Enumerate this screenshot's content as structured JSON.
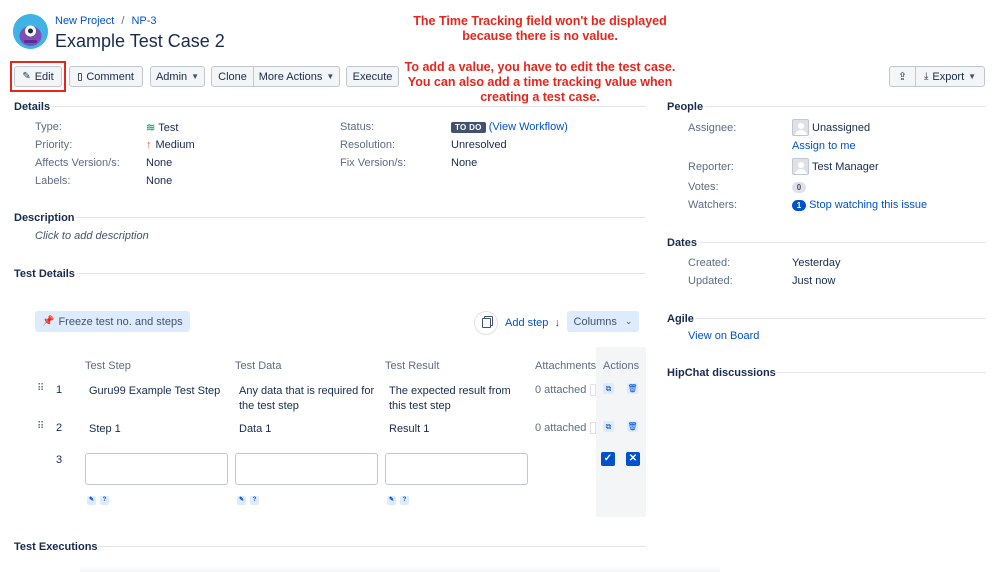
{
  "breadcrumb": {
    "project": "New Project",
    "separator": "/",
    "issue_key": "NP-3"
  },
  "issue": {
    "title": "Example Test Case 2"
  },
  "toolbar": {
    "edit": "Edit",
    "comment": "Comment",
    "admin": "Admin",
    "clone": "Clone",
    "more_actions": "More Actions",
    "execute": "Execute",
    "export": "Export"
  },
  "annotations": {
    "note1": "The Time Tracking field won't be displayed because there is no value.",
    "note2": "To add a value, you have to edit the test case. You can also add a time tracking value when creating a test case."
  },
  "details": {
    "title": "Details",
    "type_label": "Type:",
    "type_value": "Test",
    "priority_label": "Priority:",
    "priority_value": "Medium",
    "affects_label": "Affects Version/s:",
    "affects_value": "None",
    "labels_label": "Labels:",
    "labels_value": "None",
    "status_label": "Status:",
    "status_value": "TO DO",
    "view_workflow": "(View Workflow)",
    "resolution_label": "Resolution:",
    "resolution_value": "Unresolved",
    "fix_label": "Fix Version/s:",
    "fix_value": "None"
  },
  "description": {
    "title": "Description",
    "placeholder": "Click to add description"
  },
  "test_details": {
    "title": "Test Details",
    "freeze": "Freeze test no. and steps",
    "add_step": "Add step",
    "columns": "Columns",
    "headers": [
      "Test Step",
      "Test Data",
      "Test Result",
      "Attachments",
      "Actions"
    ],
    "rows": [
      {
        "num": "1",
        "step": "Guru99 Example Test Step",
        "data": "Any data that is required for the test step",
        "result": "The expected result from this test step",
        "attach": "0 attached"
      },
      {
        "num": "2",
        "step": "Step 1",
        "data": "Data 1",
        "result": "Result 1",
        "attach": "0 attached"
      }
    ],
    "new_row_num": "3"
  },
  "test_executions": {
    "title": "Test Executions"
  },
  "people": {
    "title": "People",
    "assignee_label": "Assignee:",
    "assignee_value": "Unassigned",
    "assign_to_me": "Assign to me",
    "reporter_label": "Reporter:",
    "reporter_value": "Test Manager",
    "votes_label": "Votes:",
    "votes_value": "0",
    "watchers_label": "Watchers:",
    "watchers_count": "1",
    "watchers_link": "Stop watching this issue"
  },
  "dates": {
    "title": "Dates",
    "created_label": "Created:",
    "created_value": "Yesterday",
    "updated_label": "Updated:",
    "updated_value": "Just now"
  },
  "agile": {
    "title": "Agile",
    "view_on_board": "View on Board"
  },
  "hipchat": {
    "title": "HipChat discussions"
  },
  "colors": {
    "link": "#0052cc",
    "annotation": "#e8251c",
    "highlight": "#e8251c",
    "panel": "#f4f5f7"
  }
}
